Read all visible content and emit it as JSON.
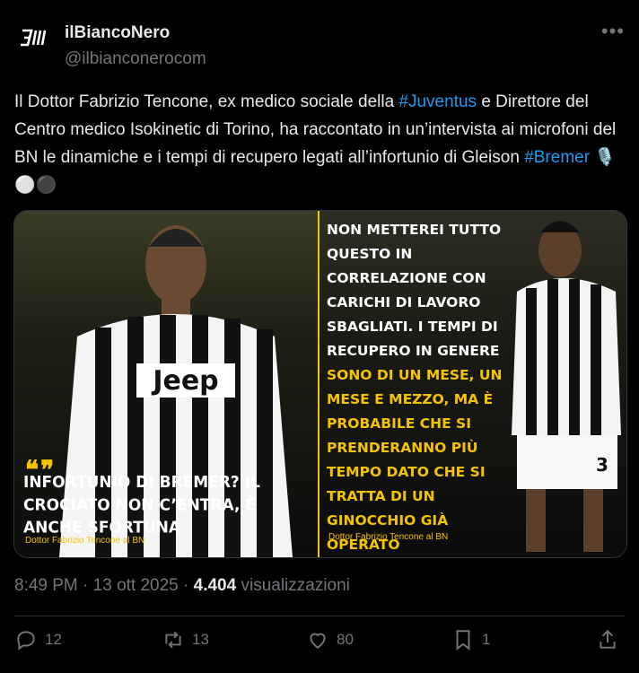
{
  "author": {
    "display_name": "ilBiancoNero",
    "handle": "@ilbianconerocom"
  },
  "tweet": {
    "text_1": "Il Dottor Fabrizio Tencone, ex medico sociale della ",
    "hashtag_1": "#Juventus",
    "text_2": " e Direttore del Centro medico Isokinetic di Torino, ha raccontato in un’intervista ai microfoni del BN le dinamiche e i tempi di recupero legati all’infortunio di Gleison ",
    "hashtag_2": "#Bremer",
    "emoji": "🎙️⚪⚫"
  },
  "media": {
    "left": {
      "quote_mark": "❝❞",
      "caption": "INFORTUNIO DI BREMER? IL CROCIATO NON C’ENTRA, È ANCHE SFORTUNA",
      "credit": "Dottor Fabrizio Tencone al BN"
    },
    "right": {
      "quote_white": "NON METTEREI TUTTO QUESTO IN CORRELAZIONE CON CARICHI DI LAVORO SBAGLIATI. I TEMPI DI RECUPERO IN GENERE ",
      "quote_yellow": "SONO DI UN MESE, UN MESE E MEZZO, MA È PROBABILE CHE SI PRENDERANNO PIÙ TEMPO DATO CHE SI TRATTA DI UN GINOCCHIO GIÀ OPERATO",
      "credit": "Dottor Fabrizio Tencone al BN"
    },
    "jersey_text": "Jeep",
    "number": "3"
  },
  "meta": {
    "time": "8:49 PM",
    "separator": " · ",
    "date": "13 ott 2025",
    "views_count": "4.404",
    "views_label": " visualizzazioni"
  },
  "actions": {
    "replies": "12",
    "reposts": "13",
    "likes": "80",
    "bookmarks": "1"
  },
  "colors": {
    "accent": "#1d9bf0",
    "yellow": "#f5c400",
    "muted": "#71767b"
  }
}
